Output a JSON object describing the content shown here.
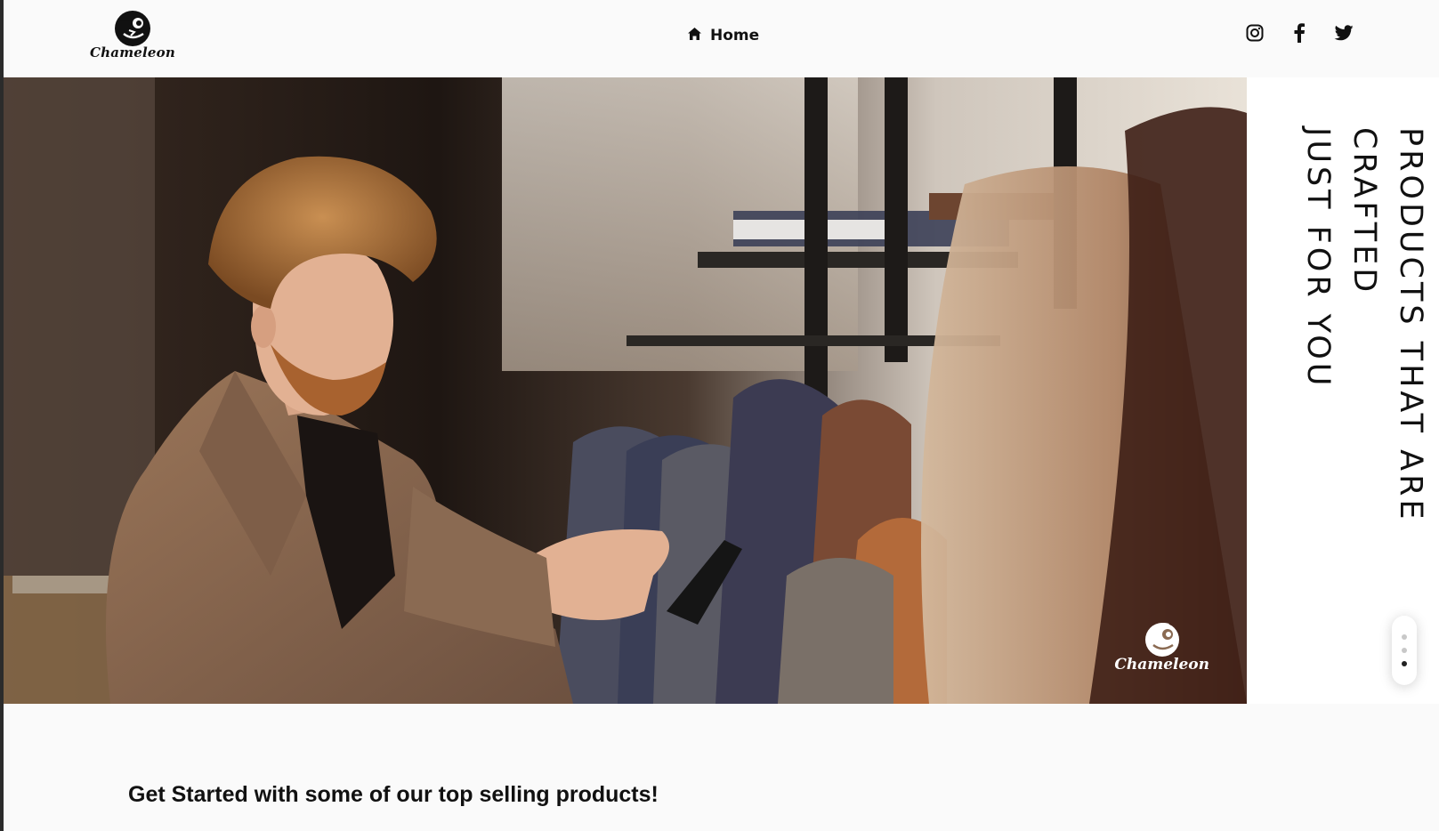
{
  "header": {
    "logo_text": "Chameleon",
    "nav": {
      "home_label": "Home",
      "home_icon": "home-icon"
    },
    "social": [
      {
        "name": "instagram",
        "icon": "instagram-icon"
      },
      {
        "name": "facebook",
        "icon": "facebook-icon"
      },
      {
        "name": "twitter",
        "icon": "twitter-icon"
      }
    ]
  },
  "hero": {
    "image_subject": "man-shopping-for-jackets",
    "watermark_text": "Chameleon",
    "tagline": "PRODUCTS THAT ARE CRAFTED\nJUST FOR YOU",
    "slider": {
      "count": 3,
      "active_index": 2
    }
  },
  "section": {
    "title": "Get Started with some of our top selling products!"
  },
  "colors": {
    "background": "#fafafa",
    "text": "#111111",
    "panel": "#ffffff",
    "hero_jacket": "#8a6a52"
  }
}
